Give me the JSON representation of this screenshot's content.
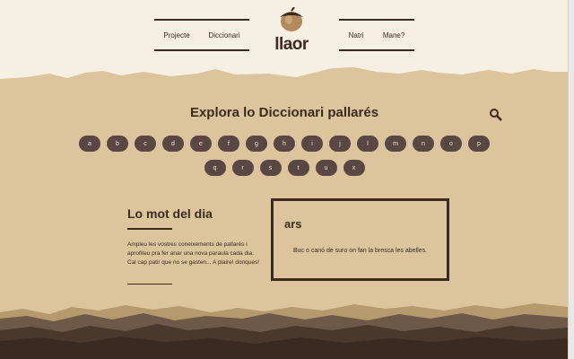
{
  "nav": {
    "left": [
      "Projecte",
      "Diccionari"
    ],
    "right": [
      "Natri",
      "Mane?"
    ]
  },
  "logo": {
    "text": "llaor",
    "icon": "acorn-icon"
  },
  "dictionary": {
    "title": "Explora lo Diccionari pallarés",
    "search_icon": "search-icon",
    "letters_row1": [
      "a",
      "b",
      "c",
      "d",
      "e",
      "f",
      "g",
      "h",
      "i",
      "j",
      "l",
      "m",
      "n",
      "o",
      "p"
    ],
    "letters_row2": [
      "q",
      "r",
      "s",
      "t",
      "u",
      "x"
    ]
  },
  "word_of_day": {
    "heading": "Lo mot del dia",
    "description": "Ampleu les vostres coneixements de pallarés i aprofiteu pra fer anar una nova paraula cada dia. Cal cap patir que no se gasten... A plaire! donques!",
    "word": "ars",
    "definition": "Buc o canó de suro on fan la bresca les abelles."
  },
  "colors": {
    "dark_brown": "#3c2a1e",
    "cream": "#f5f0e1",
    "tan": "#dcc49d",
    "button": "#5a4643"
  }
}
